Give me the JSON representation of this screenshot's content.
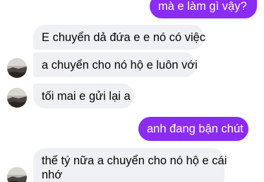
{
  "messages": [
    {
      "direction": "outgoing",
      "text": "mà e làm gì vậy?"
    },
    {
      "direction": "incoming",
      "text": "E chuyển dả đứa e e nó có việc"
    },
    {
      "direction": "incoming",
      "text": "a chuyển cho nó hộ e luôn với"
    },
    {
      "direction": "incoming",
      "text": "tối mai e gửi lại a"
    },
    {
      "direction": "outgoing",
      "text": "anh đang bận chút"
    },
    {
      "direction": "incoming",
      "text_line1": "thế tý nữa a chuyển cho nó hộ e cái",
      "text_line2": "nhớ"
    }
  ],
  "colors": {
    "outgoing_bubble": "#8b2cf5",
    "incoming_bubble": "#eff0f3",
    "background": "#ffffff"
  },
  "icons": {
    "avatar": "contact-avatar-icon"
  }
}
